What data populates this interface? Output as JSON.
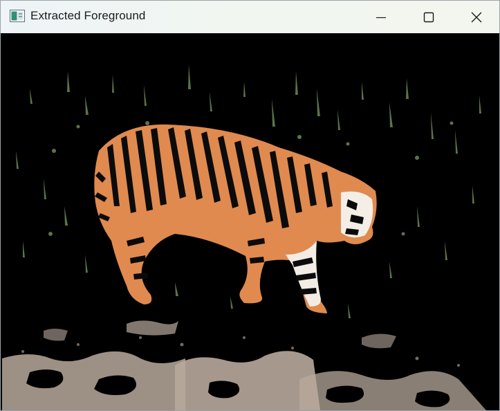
{
  "window": {
    "title": "Extracted Foreground",
    "controls": {
      "minimize": "minimize-icon",
      "maximize": "maximize-icon",
      "close": "close-icon"
    }
  },
  "image": {
    "description_icon": "app-icon",
    "colors": {
      "background": "#000000",
      "tiger_orange": "#e0894e",
      "tiger_stripe": "#0a0a0a",
      "grass": "#6f8a5a",
      "ground": "#b7a89b",
      "belly_white": "#f2ede6"
    }
  }
}
